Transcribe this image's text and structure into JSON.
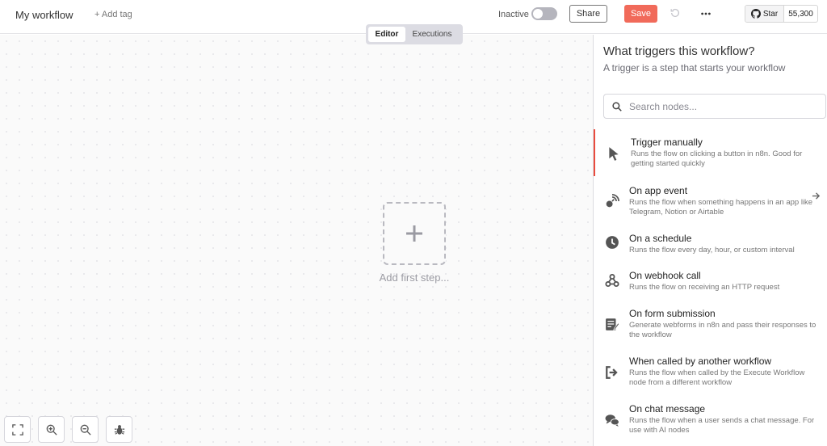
{
  "header": {
    "workflow_name": "My workflow",
    "add_tag": "+ Add tag",
    "status_label": "Inactive",
    "share_label": "Share",
    "save_label": "Save",
    "github": {
      "star_label": "Star",
      "star_count": "55,300"
    }
  },
  "view_tabs": {
    "editor": "Editor",
    "executions": "Executions"
  },
  "canvas": {
    "add_first_step": "Add first step..."
  },
  "panel": {
    "title": "What triggers this workflow?",
    "subtitle": "A trigger is a step that starts your workflow",
    "search_placeholder": "Search nodes...",
    "items": [
      {
        "title": "Trigger manually",
        "desc": "Runs the flow on clicking a button in n8n. Good for getting started quickly",
        "icon": "cursor-icon"
      },
      {
        "title": "On app event",
        "desc": "Runs the flow when something happens in an app like Telegram, Notion or Airtable",
        "icon": "satellite-icon"
      },
      {
        "title": "On a schedule",
        "desc": "Runs the flow every day, hour, or custom interval",
        "icon": "clock-icon"
      },
      {
        "title": "On webhook call",
        "desc": "Runs the flow on receiving an HTTP request",
        "icon": "webhook-icon"
      },
      {
        "title": "On form submission",
        "desc": "Generate webforms in n8n and pass their responses to the workflow",
        "icon": "form-icon"
      },
      {
        "title": "When called by another workflow",
        "desc": "Runs the flow when called by the Execute Workflow node from a different workflow",
        "icon": "sign-in-icon"
      },
      {
        "title": "On chat message",
        "desc": "Runs the flow when a user sends a chat message. For use with AI nodes",
        "icon": "chat-icon"
      }
    ]
  },
  "colors": {
    "save": "#f16a5a",
    "active_marker": "#ea4b3d"
  }
}
